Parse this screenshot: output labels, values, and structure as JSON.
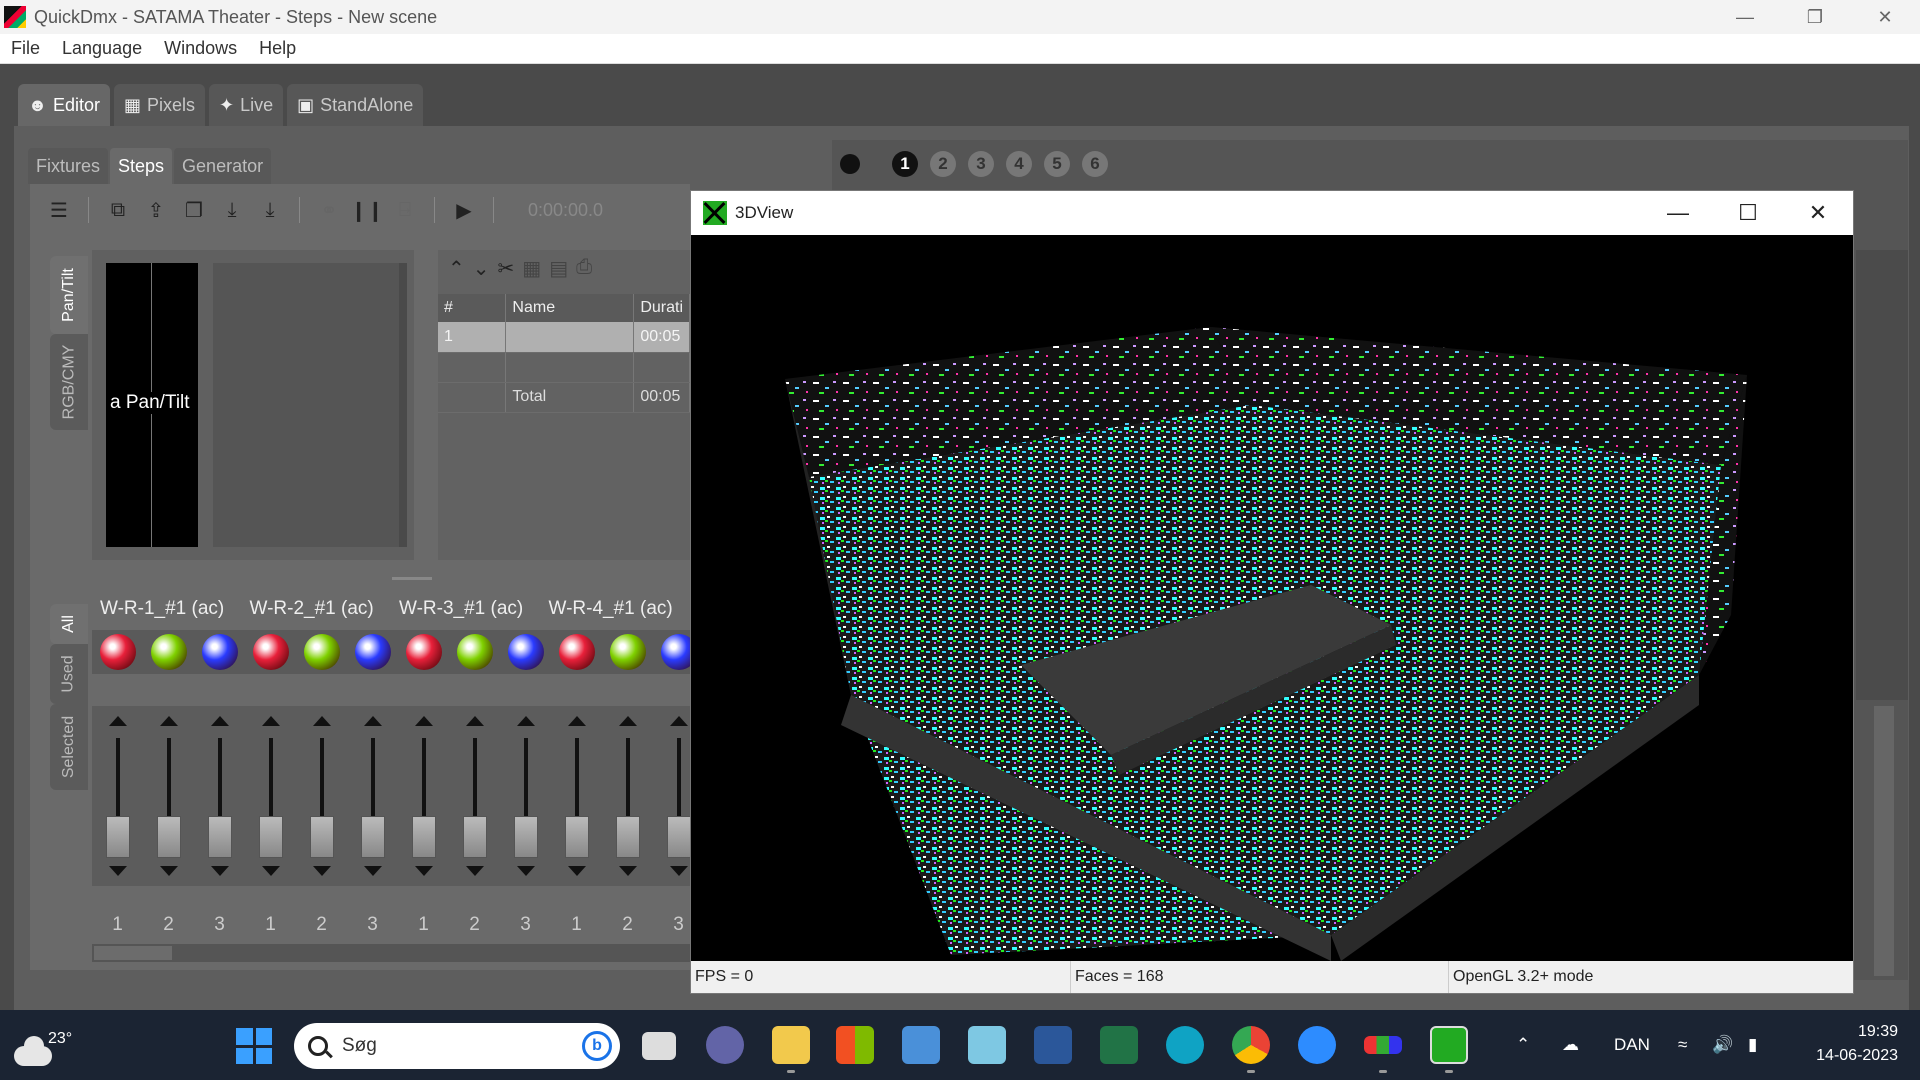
{
  "window": {
    "title": "QuickDmx - SATAMA Theater - Steps - New scene",
    "controls": [
      "—",
      "❐",
      "✕"
    ]
  },
  "menu": [
    "File",
    "Language",
    "Windows",
    "Help"
  ],
  "main_tabs": [
    {
      "label": "Editor",
      "icon": "user-icon",
      "active": true
    },
    {
      "label": "Pixels",
      "icon": "grid-icon",
      "active": false
    },
    {
      "label": "Live",
      "icon": "dancer-icon",
      "active": false
    },
    {
      "label": "StandAlone",
      "icon": "monitor-icon",
      "active": false
    }
  ],
  "sub_tabs": [
    {
      "label": "Fixtures",
      "active": false
    },
    {
      "label": "Steps",
      "active": true
    },
    {
      "label": "Generator",
      "active": false
    }
  ],
  "toolbar": {
    "timecode": "0:00:00.0"
  },
  "channel_group_tabs": [
    {
      "label": "Pan/Tilt",
      "active": true
    },
    {
      "label": "RGB/CMY",
      "active": false
    }
  ],
  "pantilt": {
    "label": "a Pan/Tilt"
  },
  "step_table": {
    "headers": [
      "#",
      "Name",
      "Durati"
    ],
    "rows": [
      {
        "num": "1",
        "name": "",
        "duration": "00:05",
        "selected": true
      },
      {
        "num": "",
        "name": "",
        "duration": "",
        "selected": false
      },
      {
        "num": "",
        "name": "Total",
        "duration": "00:05",
        "selected": false
      }
    ]
  },
  "channel_filter_tabs": [
    {
      "label": "All",
      "active": true
    },
    {
      "label": "Used",
      "active": false
    },
    {
      "label": "Selected",
      "active": false
    }
  ],
  "fixtures": [
    {
      "name": "W-R-1_#1 (ac)"
    },
    {
      "name": "W-R-2_#1 (ac)"
    },
    {
      "name": "W-R-3_#1 (ac)"
    },
    {
      "name": "W-R-4_#1 (ac)"
    }
  ],
  "channels": [
    "1",
    "2",
    "3",
    "1",
    "2",
    "3",
    "1",
    "2",
    "3",
    "1",
    "2",
    "3"
  ],
  "led_colors": [
    "#e8203a",
    "#7fd100",
    "#2a3bff"
  ],
  "scenes": {
    "numbers": [
      "1",
      "2",
      "3",
      "4",
      "5",
      "6"
    ],
    "active": "1"
  },
  "view3d": {
    "title": "3DView",
    "status": {
      "fps": "FPS = 0",
      "faces": "Faces = 168",
      "mode": "OpenGL 3.2+ mode"
    }
  },
  "taskbar": {
    "weather_temp": "23°",
    "search_placeholder": "Søg",
    "bing_label": "b",
    "language": "DAN",
    "time": "19:39",
    "date": "14-06-2023"
  }
}
